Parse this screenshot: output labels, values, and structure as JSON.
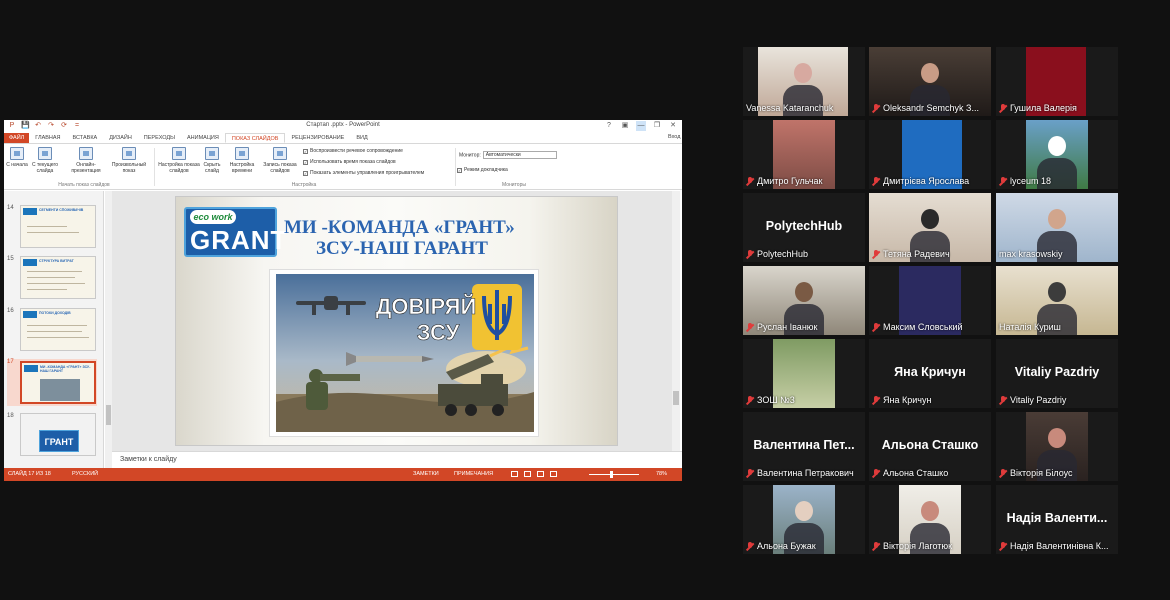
{
  "ppt": {
    "window_title": "Стартап .pptx - PowerPoint",
    "quick_access": [
      "P",
      "💾",
      "↶",
      "↷",
      "⟳",
      "="
    ],
    "window_controls": [
      "?",
      "▣",
      "—",
      "❐",
      "✕"
    ],
    "tabs": [
      "ФАЙЛ",
      "ГЛАВНАЯ",
      "ВСТАВКА",
      "ДИЗАЙН",
      "ПЕРЕХОДЫ",
      "АНИМАЦИЯ",
      "ПОКАЗ СЛАЙДОВ",
      "РЕЦЕНЗИРОВАНИЕ",
      "ВИД"
    ],
    "active_tab": "ПОКАЗ СЛАЙДОВ",
    "signin": "Вход",
    "ribbon": {
      "btn_from_start": "С начала",
      "btn_from_current": "С текущего слайда",
      "btn_online": "Онлайн-презентация",
      "btn_custom": "Произвольный показ",
      "btn_setup": "Настройка показа слайдов",
      "btn_hide": "Скрыть слайд",
      "btn_rehearse": "Настройка времени",
      "btn_record": "Запись показа слайдов",
      "group_start": "Начать показ слайдов",
      "group_setup": "Настройка",
      "group_monitors": "Мониторы",
      "chk_narration": "Воспроизвести речевое сопровождение",
      "chk_timings": "Использовать время показа слайдов",
      "chk_media": "Показать элементы управления проигрывателем",
      "monitor_label": "Монитор:",
      "monitor_value": "Автоматически",
      "chk_presenter": "Режим докладчика"
    },
    "thumbnails": [
      {
        "num": "14",
        "title": "СЕГМЕНТИ СПОЖИВАЧІВ"
      },
      {
        "num": "15",
        "title": "СТРУКТУРА ВИТРАТ"
      },
      {
        "num": "16",
        "title": "ПОТОКИ ДОХОДІВ"
      },
      {
        "num": "17",
        "title": "МИ -КОМАНДА «ГРАНТ» ЗСУ-НАШ ГАРАНТ"
      },
      {
        "num": "18",
        "title": "ГРАНТ"
      }
    ],
    "slide": {
      "logo_top": "eco work",
      "logo_main": "GRANT",
      "title_line1": "МИ -КОМАНДА «ГРАНТ»",
      "title_line2": "ЗСУ-НАШ ГАРАНТ",
      "poster_line1": "ДОВІРЯЙ",
      "poster_line2": "ЗСУ"
    },
    "notes_placeholder": "Заметки к слайду",
    "status": {
      "slide_counter": "СЛАЙД 17 ИЗ 18",
      "language": "РУССКИЙ",
      "notes": "ЗАМЕТКИ",
      "comments": "ПРИМЕЧАНИЯ",
      "zoom": "78%"
    }
  },
  "participants": [
    {
      "name": "Vanessa Kataranchuk",
      "muted": false,
      "kind": "video"
    },
    {
      "name": "Oleksandr Semchyk З...",
      "muted": true,
      "kind": "video"
    },
    {
      "name": "Гушила Валерія",
      "muted": true,
      "kind": "video"
    },
    {
      "name": "Дмитро Гульчак",
      "muted": true,
      "kind": "video"
    },
    {
      "name": "Дмитрієва Ярослава",
      "muted": true,
      "kind": "video"
    },
    {
      "name": "lyceum 18",
      "muted": true,
      "kind": "video"
    },
    {
      "name": "PolytechHub",
      "muted": true,
      "kind": "text",
      "big": "PolytechHub"
    },
    {
      "name": "Тетяна Радевич",
      "muted": true,
      "kind": "video"
    },
    {
      "name": "max krasowskiy",
      "muted": false,
      "kind": "video"
    },
    {
      "name": "Руслан Іванюк",
      "muted": true,
      "kind": "video"
    },
    {
      "name": "Максим Словський",
      "muted": true,
      "kind": "video"
    },
    {
      "name": "Наталія Куриш",
      "muted": false,
      "kind": "video"
    },
    {
      "name": "ЗОШ №3",
      "muted": true,
      "kind": "video"
    },
    {
      "name": "Яна Кричун",
      "muted": true,
      "kind": "text",
      "big": "Яна Кричун"
    },
    {
      "name": "Vitaliy Pazdriy",
      "muted": true,
      "kind": "text",
      "big": "Vitaliy Pazdriy"
    },
    {
      "name": "Валентина Петракович",
      "muted": true,
      "kind": "text",
      "big": "Валентина Пет..."
    },
    {
      "name": "Альона Сташко",
      "muted": true,
      "kind": "text",
      "big": "Альона Сташко"
    },
    {
      "name": "Вікторія Білоус",
      "muted": true,
      "kind": "video"
    },
    {
      "name": "Альона Бужак",
      "muted": true,
      "kind": "video"
    },
    {
      "name": "Вікторія Лаготюк",
      "muted": true,
      "kind": "video"
    },
    {
      "name": "Надія Валентинівна К...",
      "muted": true,
      "kind": "text",
      "big": "Надія Валенти..."
    }
  ],
  "colors": {
    "ppt_accent": "#d24726",
    "slide_title": "#2b64b0",
    "zoom_bg": "#111111",
    "active_speaker": "#c4d63a",
    "mute_red": "#e03b3b"
  }
}
